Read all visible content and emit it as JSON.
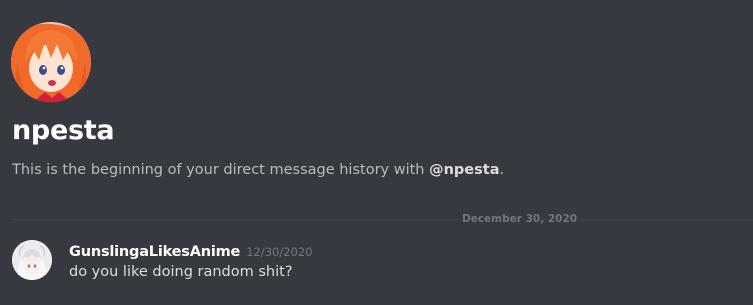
{
  "channel": {
    "name": "npesta",
    "intro_prefix": "This is the beginning of your direct message history with ",
    "intro_mention": "@npesta",
    "intro_suffix": "."
  },
  "divider": {
    "date": "December 30, 2020"
  },
  "messages": [
    {
      "author": "GunslingaLikesAnime",
      "timestamp": "12/30/2020",
      "text": "do you like doing random shit?"
    }
  ],
  "icons": {
    "dm_avatar": "anime-girl-avatar-icon",
    "author_avatar": "white-haired-anime-avatar-icon"
  },
  "colors": {
    "background": "#36393f",
    "name": "#ffffff",
    "intro_text": "#b9bbbe",
    "divider_line": "#42454a",
    "muted": "#72767d",
    "message_text": "#dcddde"
  }
}
